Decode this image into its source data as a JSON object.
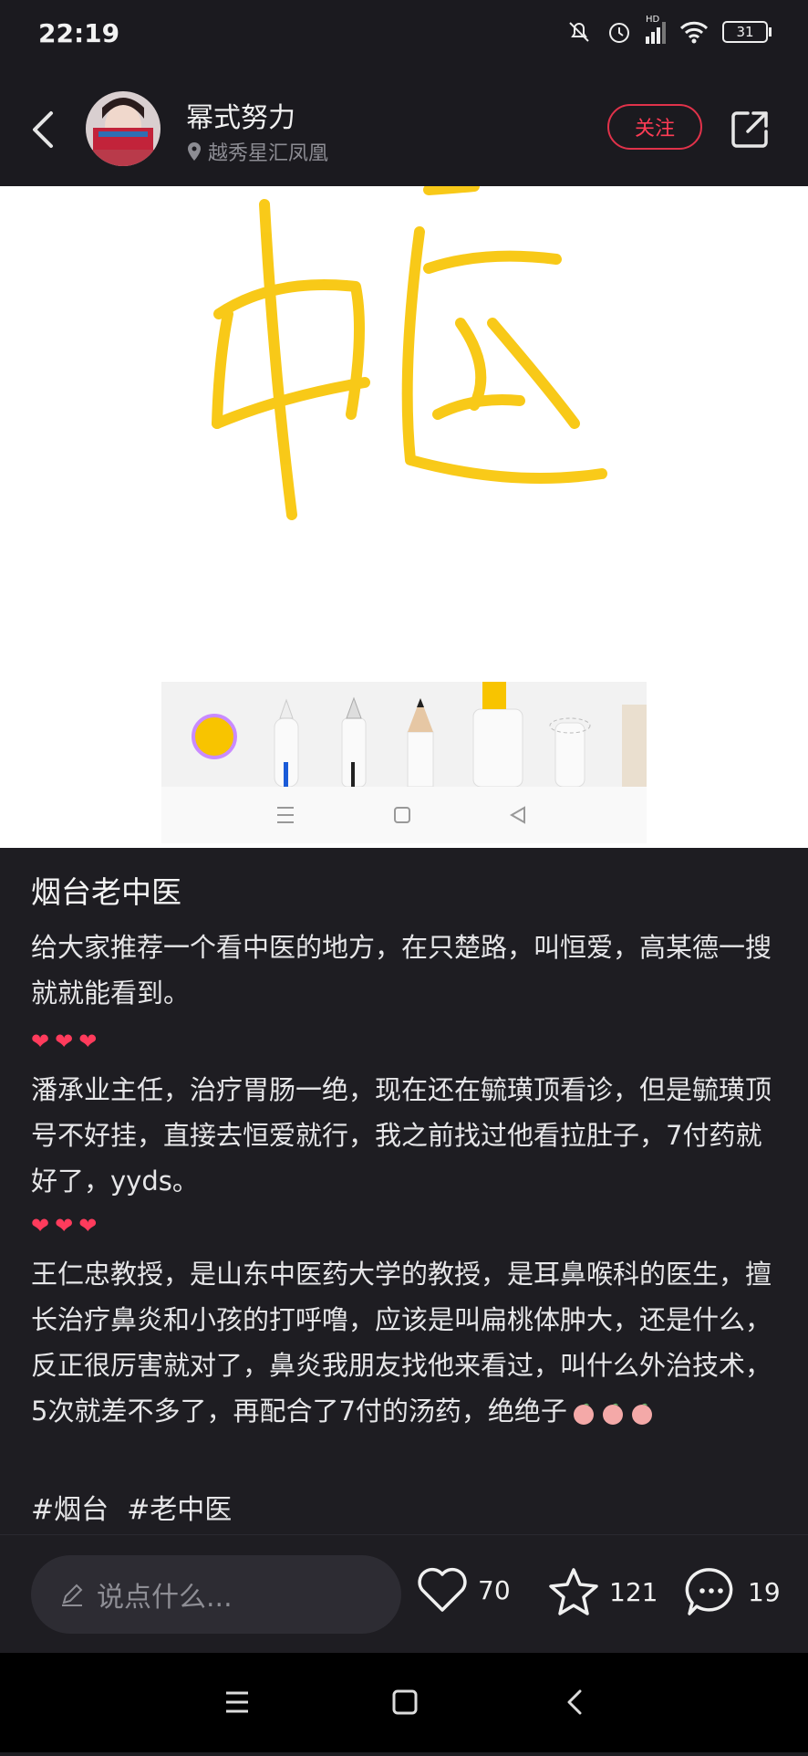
{
  "status": {
    "time": "22:19",
    "battery": "31",
    "network_badge": "HD"
  },
  "header": {
    "username": "幂式努力",
    "location": "越秀星汇凤凰",
    "follow_label": "关注"
  },
  "photo": {
    "handwriting": "中医",
    "stroke_color": "#f8c400"
  },
  "post": {
    "title": "烟台老中医",
    "intro": "给大家推荐一个看中医的地方，在只楚路，叫恒爱，高某德一搜就就能看到。",
    "hearts1": "❤❤❤",
    "para1": "潘承业主任，治疗胃肠一绝，现在还在毓璜顶看诊，但是毓璜顶号不好挂，直接去恒爱就行，我之前找过他看拉肚子，7付药就好了，yyds。",
    "hearts2": "❤❤❤",
    "para2": "王仁忠教授，是山东中医药大学的教授，是耳鼻喉科的医生，擅长治疗鼻炎和小孩的打呼噜，应该是叫扁桃体肿大，还是什么，反正很厉害就对了，鼻炎我朋友找他来看过，叫什么外治技术，5次就差不多了，再配合了7付的汤药，绝绝子",
    "tags": [
      "#烟台",
      "#老中医"
    ]
  },
  "bottom": {
    "comment_placeholder": "说点什么...",
    "likes": "70",
    "favorites": "121",
    "comments": "19"
  },
  "colors": {
    "accent_red": "#ff3c55",
    "bg": "#1e1d22"
  }
}
